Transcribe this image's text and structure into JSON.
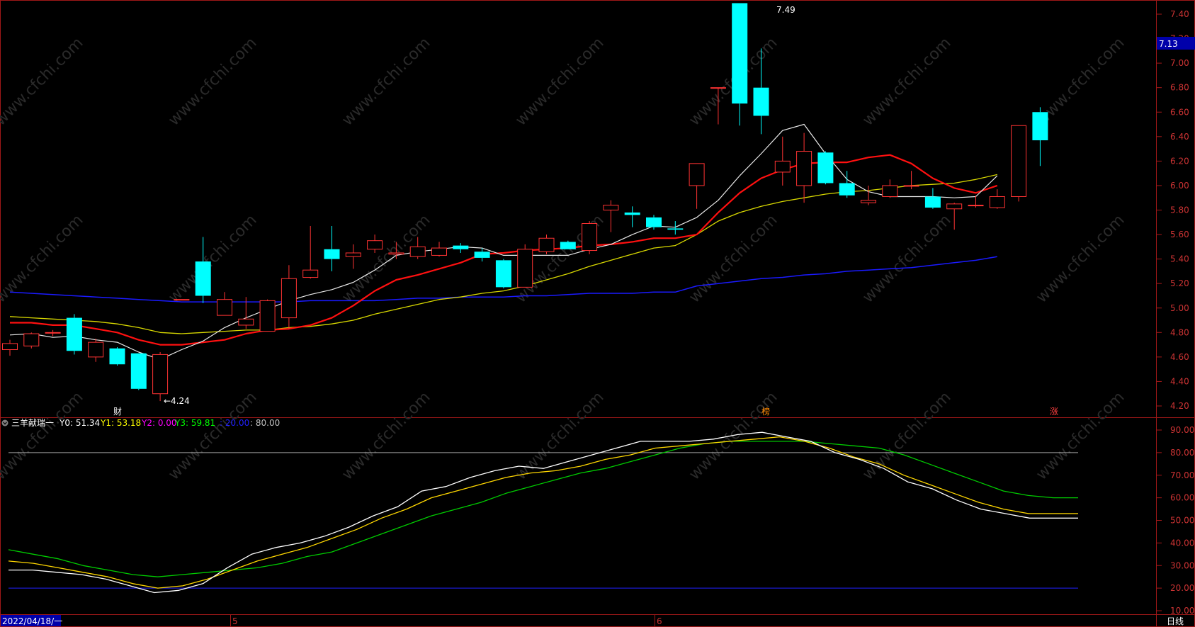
{
  "app": {
    "date_label": "2022/04/18/一",
    "period_label": "日线",
    "month_marks": [
      "5",
      "6"
    ],
    "event_marks": [
      "财",
      "榜",
      "涨"
    ],
    "watermark": "www.cfchi.com"
  },
  "price_panel": {
    "y_ticks": [
      "7.40",
      "7.20",
      "7.00",
      "6.80",
      "6.60",
      "6.40",
      "6.20",
      "6.00",
      "5.80",
      "5.60",
      "5.40",
      "5.20",
      "5.00",
      "4.80",
      "4.60",
      "4.40",
      "4.20"
    ],
    "current_price_label": "7.13",
    "high_label": "7.49",
    "low_label": "←4.24",
    "y_range": [
      4.15,
      7.49
    ],
    "candles": [
      {
        "o": 4.66,
        "h": 4.74,
        "l": 4.61,
        "c": 4.71
      },
      {
        "o": 4.69,
        "h": 4.8,
        "l": 4.67,
        "c": 4.79
      },
      {
        "o": 4.8,
        "h": 4.82,
        "l": 4.77,
        "c": 4.8
      },
      {
        "o": 4.92,
        "h": 4.95,
        "l": 4.62,
        "c": 4.65
      },
      {
        "o": 4.6,
        "h": 4.75,
        "l": 4.56,
        "c": 4.72
      },
      {
        "o": 4.67,
        "h": 4.68,
        "l": 4.53,
        "c": 4.54
      },
      {
        "o": 4.63,
        "h": 4.63,
        "l": 4.33,
        "c": 4.34
      },
      {
        "o": 4.3,
        "h": 4.64,
        "l": 4.24,
        "c": 4.62
      },
      {
        "o": 5.07,
        "h": 5.07,
        "l": 5.07,
        "c": 5.07
      },
      {
        "o": 5.38,
        "h": 5.58,
        "l": 5.04,
        "c": 5.1
      },
      {
        "o": 4.94,
        "h": 5.13,
        "l": 4.94,
        "c": 5.07
      },
      {
        "o": 4.86,
        "h": 5.09,
        "l": 4.83,
        "c": 4.91
      },
      {
        "o": 4.81,
        "h": 5.07,
        "l": 4.81,
        "c": 5.06
      },
      {
        "o": 4.92,
        "h": 5.35,
        "l": 4.83,
        "c": 5.24
      },
      {
        "o": 5.25,
        "h": 5.67,
        "l": 5.24,
        "c": 5.31
      },
      {
        "o": 5.48,
        "h": 5.67,
        "l": 5.3,
        "c": 5.4
      },
      {
        "o": 5.42,
        "h": 5.52,
        "l": 5.32,
        "c": 5.45
      },
      {
        "o": 5.48,
        "h": 5.6,
        "l": 5.45,
        "c": 5.55
      },
      {
        "o": 5.44,
        "h": 5.54,
        "l": 5.4,
        "c": 5.45
      },
      {
        "o": 5.42,
        "h": 5.58,
        "l": 5.4,
        "c": 5.5
      },
      {
        "o": 5.43,
        "h": 5.54,
        "l": 5.42,
        "c": 5.49
      },
      {
        "o": 5.51,
        "h": 5.53,
        "l": 5.45,
        "c": 5.48
      },
      {
        "o": 5.46,
        "h": 5.49,
        "l": 5.38,
        "c": 5.41
      },
      {
        "o": 5.39,
        "h": 5.4,
        "l": 5.16,
        "c": 5.17
      },
      {
        "o": 5.17,
        "h": 5.52,
        "l": 5.17,
        "c": 5.48
      },
      {
        "o": 5.46,
        "h": 5.6,
        "l": 5.44,
        "c": 5.57
      },
      {
        "o": 5.54,
        "h": 5.55,
        "l": 5.48,
        "c": 5.48
      },
      {
        "o": 5.47,
        "h": 5.71,
        "l": 5.44,
        "c": 5.69
      },
      {
        "o": 5.8,
        "h": 5.88,
        "l": 5.62,
        "c": 5.84
      },
      {
        "o": 5.78,
        "h": 5.83,
        "l": 5.66,
        "c": 5.76
      },
      {
        "o": 5.74,
        "h": 5.76,
        "l": 5.64,
        "c": 5.66
      },
      {
        "o": 5.65,
        "h": 5.71,
        "l": 5.6,
        "c": 5.64
      },
      {
        "o": 6.0,
        "h": 6.18,
        "l": 5.81,
        "c": 6.18
      },
      {
        "o": 6.8,
        "h": 6.8,
        "l": 6.5,
        "c": 6.8
      },
      {
        "o": 7.49,
        "h": 7.49,
        "l": 6.49,
        "c": 6.67
      },
      {
        "o": 6.8,
        "h": 7.12,
        "l": 6.42,
        "c": 6.57
      },
      {
        "o": 6.11,
        "h": 6.4,
        "l": 6.0,
        "c": 6.2
      },
      {
        "o": 6.0,
        "h": 6.43,
        "l": 5.86,
        "c": 6.28
      },
      {
        "o": 6.27,
        "h": 6.28,
        "l": 6.01,
        "c": 6.02
      },
      {
        "o": 6.02,
        "h": 6.12,
        "l": 5.9,
        "c": 5.92
      },
      {
        "o": 5.86,
        "h": 6.0,
        "l": 5.84,
        "c": 5.88
      },
      {
        "o": 5.91,
        "h": 6.05,
        "l": 5.9,
        "c": 6.0
      },
      {
        "o": 6.0,
        "h": 6.12,
        "l": 5.97,
        "c": 6.0
      },
      {
        "o": 5.91,
        "h": 5.98,
        "l": 5.81,
        "c": 5.82
      },
      {
        "o": 5.81,
        "h": 5.86,
        "l": 5.64,
        "c": 5.85
      },
      {
        "o": 5.84,
        "h": 5.92,
        "l": 5.82,
        "c": 5.84
      },
      {
        "o": 5.82,
        "h": 5.97,
        "l": 5.81,
        "c": 5.91
      },
      {
        "o": 5.91,
        "h": 6.49,
        "l": 5.87,
        "c": 6.49
      },
      {
        "o": 6.6,
        "h": 6.64,
        "l": 6.16,
        "c": 6.37
      }
    ],
    "ma_white": [
      4.78,
      4.79,
      4.76,
      4.77,
      4.74,
      4.72,
      4.64,
      4.58,
      4.66,
      4.73,
      4.84,
      4.92,
      4.99,
      5.06,
      5.11,
      5.15,
      5.21,
      5.31,
      5.43,
      5.46,
      5.48,
      5.5,
      5.49,
      5.43,
      5.43,
      5.43,
      5.43,
      5.48,
      5.52,
      5.6,
      5.67,
      5.66,
      5.74,
      5.88,
      6.08,
      6.26,
      6.45,
      6.5,
      6.26,
      6.05,
      5.95,
      5.91,
      5.91,
      5.91,
      5.9,
      5.91,
      6.08
    ],
    "ma_red": [
      4.88,
      4.88,
      4.86,
      4.86,
      4.83,
      4.8,
      4.74,
      4.7,
      4.7,
      4.72,
      4.74,
      4.79,
      4.82,
      4.83,
      4.86,
      4.92,
      5.02,
      5.14,
      5.23,
      5.27,
      5.32,
      5.37,
      5.44,
      5.45,
      5.47,
      5.48,
      5.49,
      5.51,
      5.52,
      5.54,
      5.57,
      5.57,
      5.6,
      5.78,
      5.94,
      6.06,
      6.13,
      6.18,
      6.19,
      6.19,
      6.23,
      6.25,
      6.18,
      6.06,
      5.98,
      5.94,
      6.0
    ],
    "ma_yellow": [
      4.93,
      4.92,
      4.91,
      4.9,
      4.89,
      4.87,
      4.84,
      4.8,
      4.79,
      4.8,
      4.81,
      4.82,
      4.82,
      4.84,
      4.85,
      4.87,
      4.9,
      4.95,
      4.99,
      5.03,
      5.07,
      5.09,
      5.12,
      5.14,
      5.18,
      5.23,
      5.28,
      5.34,
      5.39,
      5.44,
      5.49,
      5.51,
      5.6,
      5.71,
      5.78,
      5.83,
      5.87,
      5.9,
      5.93,
      5.95,
      5.96,
      5.98,
      6.0,
      6.01,
      6.02,
      6.05,
      6.09
    ],
    "ma_blue": [
      5.13,
      5.12,
      5.11,
      5.1,
      5.09,
      5.08,
      5.07,
      5.06,
      5.05,
      5.05,
      5.05,
      5.05,
      5.05,
      5.05,
      5.06,
      5.06,
      5.06,
      5.06,
      5.07,
      5.08,
      5.08,
      5.09,
      5.09,
      5.09,
      5.1,
      5.1,
      5.11,
      5.12,
      5.12,
      5.12,
      5.13,
      5.13,
      5.18,
      5.2,
      5.22,
      5.24,
      5.25,
      5.27,
      5.28,
      5.3,
      5.31,
      5.32,
      5.33,
      5.35,
      5.37,
      5.39,
      5.42
    ]
  },
  "indicator_panel": {
    "name": "三羊献瑞一",
    "legend": [
      {
        "label": "Y0: 51.34",
        "color": "#ffffff"
      },
      {
        "label": "Y1: 53.18",
        "color": "#ffff00"
      },
      {
        "label": "Y2: 0.00",
        "color": "#ff00ff"
      },
      {
        "label": "Y3: 59.81",
        "color": "#00ff00"
      },
      {
        "label": ": 20.00",
        "color": "#2020ff"
      },
      {
        "label": ": 80.00",
        "color": "#c0c0c0"
      }
    ],
    "y_ticks": [
      "90.00",
      "80.00",
      "70.00",
      "60.00",
      "50.00",
      "40.00",
      "30.00",
      "20.00",
      "10.00"
    ],
    "y_range": [
      0,
      95
    ],
    "Y0": [
      28,
      28,
      27,
      26,
      24,
      21,
      18,
      19,
      22,
      29,
      35,
      38,
      40,
      43,
      47,
      52,
      56,
      63,
      65,
      69,
      72,
      74,
      73,
      76,
      79,
      82,
      85,
      85,
      85,
      86,
      88,
      89,
      87,
      85,
      80,
      77,
      73,
      67,
      64,
      59,
      55,
      53,
      51,
      51,
      51
    ],
    "Y1": [
      32,
      31,
      29,
      27,
      25,
      22,
      20,
      21,
      24,
      28,
      32,
      35,
      38,
      42,
      46,
      51,
      55,
      60,
      63,
      66,
      69,
      71,
      72,
      74,
      77,
      79,
      82,
      83,
      84,
      85,
      86,
      87,
      85,
      82,
      78,
      75,
      70,
      66,
      62,
      58,
      55,
      53,
      53,
      53
    ],
    "Y3": [
      37,
      35,
      33,
      30,
      28,
      26,
      25,
      26,
      27,
      28,
      29,
      31,
      34,
      36,
      40,
      44,
      48,
      52,
      55,
      58,
      62,
      65,
      68,
      71,
      73,
      76,
      79,
      82,
      84,
      85,
      85,
      85,
      85,
      84,
      83,
      82,
      79,
      75,
      71,
      67,
      63,
      61,
      60,
      60
    ]
  },
  "colors": {
    "up": "#ff3333",
    "down": "#00ffff",
    "ma_white": "#e8e8e8",
    "ma_red": "#ff1010",
    "ma_yellow": "#d8d800",
    "ma_blue": "#1a1aff",
    "Y0": "#ffffff",
    "Y1": "#ffd700",
    "Y2": "#ff00ff",
    "Y3": "#00cc00",
    "line80": "#a0a0a0",
    "line20": "#2020ff",
    "frame": "#a01818",
    "axis_text": "#cc3333"
  }
}
